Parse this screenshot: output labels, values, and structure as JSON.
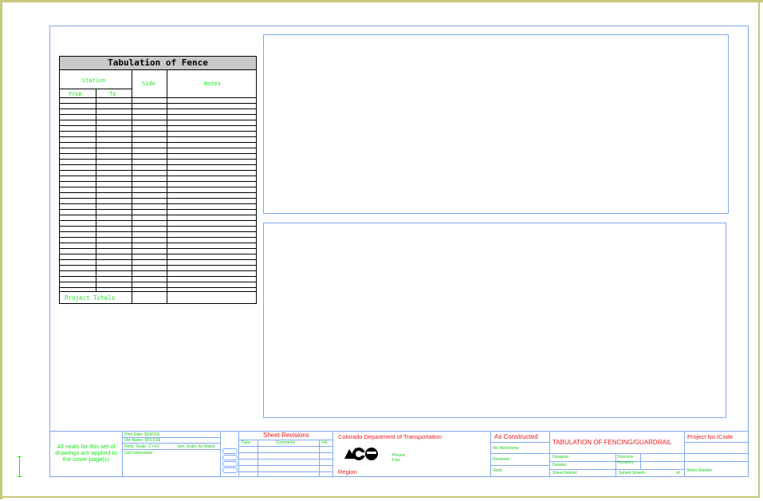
{
  "table": {
    "title": "Tabulation of Fence",
    "station": "Station",
    "from": "From",
    "to": "To",
    "side": "Side",
    "notes": "Notes",
    "totals": "Project Totals"
  },
  "titleblock": {
    "seals": "All seals for this set of drawings are applied to the cover page(s)",
    "print_date": "Print Date: $DATE$",
    "file_name": "File Name: $FILES$",
    "horiz_scale": "Horiz. Scale: 1\"=XX'",
    "vert_scale": "Vert. Scale: As Noted",
    "unit_info": "Unit Information:",
    "sheet_revisions": "Sheet Revisions",
    "date": "Date:",
    "comments": "Comments",
    "init": "Init.",
    "cdot": "Colorado Department of Transportation",
    "phone": "Phone:",
    "fax": "Fax:",
    "region": "Region",
    "as_constructed": "As Constructed",
    "no_revisions": "No Revisions:",
    "revised": "Revised:",
    "void": "Void:",
    "sheet_title": "TABULATION OF FENCING/GUARDRAIL",
    "designer": "Designer:",
    "detailer": "Detailer:",
    "structure": "Structure",
    "numbers": "Numbers",
    "sheet_subset": "Sheet Subset:",
    "subset_sheets": "Subset Sheets:",
    "of": "of",
    "project_no": "Project No./Code",
    "sheet_number": "Sheet Number"
  },
  "colors": {
    "border": "#c8c87a",
    "blue": "#7fa8f0",
    "green": "#19e619",
    "red": "#e61919"
  }
}
